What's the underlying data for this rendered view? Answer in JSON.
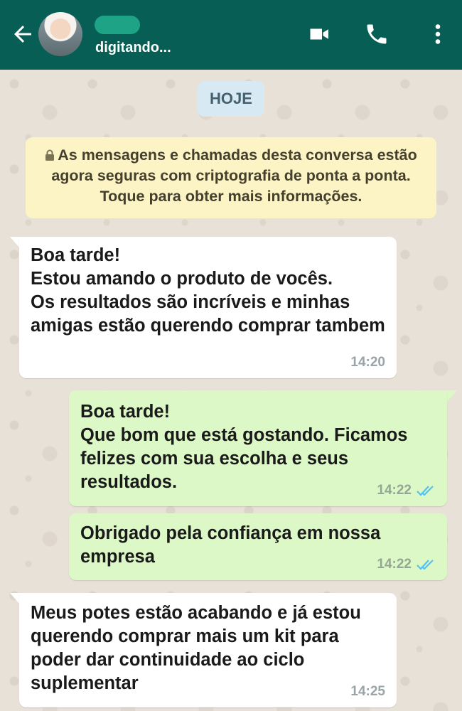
{
  "header": {
    "status": "digitando...",
    "icons": [
      "back-arrow-icon",
      "video-call-icon",
      "phone-icon",
      "more-vert-icon"
    ]
  },
  "date_chip": "HOJE",
  "encryption_notice": "As mensagens e chamadas desta conversa estão agora seguras com criptografia de ponta a ponta. Toque para obter mais informações.",
  "messages": [
    {
      "direction": "incoming",
      "text": "Boa tarde!\nEstou amando o produto de vocês.\nOs resultados são incríveis e minhas amigas estão querendo comprar tambem",
      "time": "14:20"
    },
    {
      "direction": "outgoing",
      "text": "Boa tarde!\nQue bom que está gostando. Ficamos felizes com sua escolha e seus resultados.",
      "time": "14:22",
      "status_icon": "double-check-icon"
    },
    {
      "direction": "outgoing",
      "text": "Obrigado pela confiança em nossa empresa",
      "time": "14:22",
      "status_icon": "double-check-icon"
    },
    {
      "direction": "incoming",
      "text": "Meus potes estão acabando e já estou querendo comprar mais um kit para poder dar continuidade ao ciclo suplementar",
      "time": "14:25"
    }
  ],
  "colors": {
    "header": "#075e54",
    "incoming_bubble": "#ffffff",
    "outgoing_bubble": "#dcf8c6",
    "notice": "#fcf4c4",
    "date_chip": "#d7eaf4",
    "read_ticks": "#4fc3f7"
  }
}
